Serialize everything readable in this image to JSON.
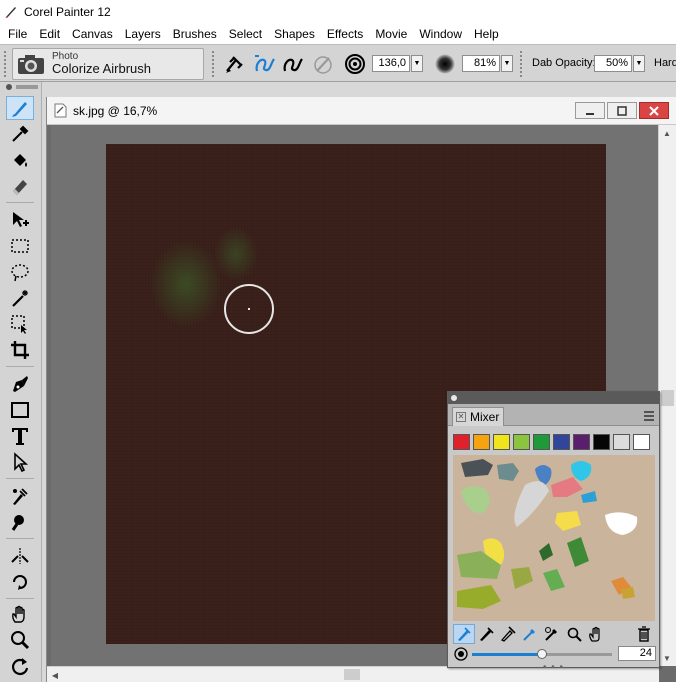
{
  "window": {
    "title": "Corel Painter 12"
  },
  "menu": [
    "File",
    "Edit",
    "Canvas",
    "Layers",
    "Brushes",
    "Select",
    "Shapes",
    "Effects",
    "Movie",
    "Window",
    "Help"
  ],
  "property_bar": {
    "brush_category": "Photo",
    "brush_variant": "Colorize Airbrush",
    "size_value": "136,0",
    "opacity_value": "81%",
    "dab_opacity_label": "Dab Opacity:",
    "dab_opacity_value": "50%",
    "hardness_label": "Hard"
  },
  "document": {
    "title": "sk.jpg @ 16,7%"
  },
  "mixer": {
    "tab_label": "Mixer",
    "swatches": [
      "#e0202a",
      "#f5a30f",
      "#f2e41c",
      "#8bc53f",
      "#1e9a3a",
      "#31469a",
      "#5b1e6e",
      "#050505",
      "#dcdcdc",
      "#ffffff"
    ],
    "brush_size": "24"
  },
  "colors": {
    "canvas": "#3b211b",
    "accent": "#1b7fd4"
  }
}
